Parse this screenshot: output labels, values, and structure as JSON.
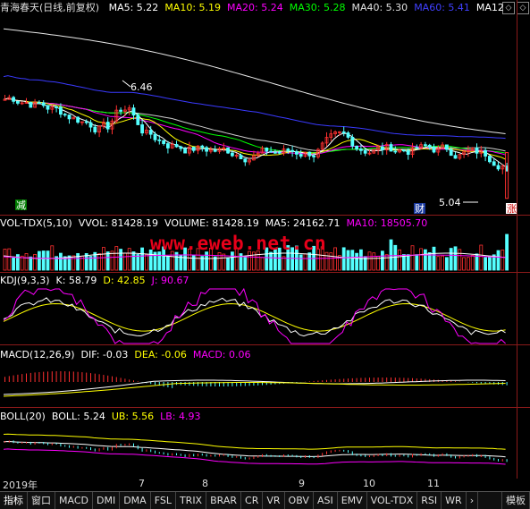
{
  "main_panel": {
    "title": "青海春天(日线,前复权)",
    "ma": [
      {
        "label": "MA5: 5.22",
        "color": "#ffffff"
      },
      {
        "label": "MA10: 5.19",
        "color": "#ffff00"
      },
      {
        "label": "MA20: 5.24",
        "color": "#ff00ff"
      },
      {
        "label": "MA30: 5.28",
        "color": "#00ff00"
      },
      {
        "label": "MA40: 5.30",
        "color": "#e0e0e0"
      },
      {
        "label": "MA60: 5.41",
        "color": "#4040ff"
      },
      {
        "label": "MA12",
        "color": "#ffffff"
      }
    ],
    "high_marker": "6.46",
    "low_marker": "5.04",
    "badge_left": "减",
    "badge_mid": "财",
    "badge_right": "涨"
  },
  "vol_panel": {
    "items": [
      {
        "label": "VOL-TDX(5,10)",
        "color": "#ffffff"
      },
      {
        "label": "VVOL: 81428.19",
        "color": "#ffffff"
      },
      {
        "label": "VOLUME: 81428.19",
        "color": "#ffffff"
      },
      {
        "label": "MA5: 24162.71",
        "color": "#ffffff"
      },
      {
        "label": "MA10: 18505.70",
        "color": "#ff00ff"
      }
    ]
  },
  "kdj_panel": {
    "items": [
      {
        "label": "KDJ(9,3,3)",
        "color": "#ffffff"
      },
      {
        "label": "K: 58.79",
        "color": "#ffffff"
      },
      {
        "label": "D: 42.85",
        "color": "#ffff00"
      },
      {
        "label": "J: 90.67",
        "color": "#ff00ff"
      }
    ]
  },
  "macd_panel": {
    "items": [
      {
        "label": "MACD(12,26,9)",
        "color": "#ffffff"
      },
      {
        "label": "DIF: -0.03",
        "color": "#ffffff"
      },
      {
        "label": "DEA: -0.06",
        "color": "#ffff00"
      },
      {
        "label": "MACD: 0.06",
        "color": "#ff00ff"
      }
    ]
  },
  "boll_panel": {
    "items": [
      {
        "label": "BOLL(20)",
        "color": "#ffffff"
      },
      {
        "label": "BOLL: 5.24",
        "color": "#ffffff"
      },
      {
        "label": "UB: 5.56",
        "color": "#ffff00"
      },
      {
        "label": "LB: 4.93",
        "color": "#ff00ff"
      }
    ]
  },
  "watermark": "www.eweb.net.cn",
  "date_axis": [
    "2019年",
    "7",
    "8",
    "9",
    "10",
    "11"
  ],
  "tabs": [
    "指标",
    "窗口",
    "MACD",
    "DMI",
    "DMA",
    "FSL",
    "TRIX",
    "BRAR",
    "CR",
    "VR",
    "OBV",
    "ASI",
    "EMV",
    "VOL-TDX",
    "RSI",
    "WR"
  ],
  "tab_arrow": "›",
  "template_tab": "模板",
  "scroll_up": "◇",
  "scroll_dn": "◇"
}
